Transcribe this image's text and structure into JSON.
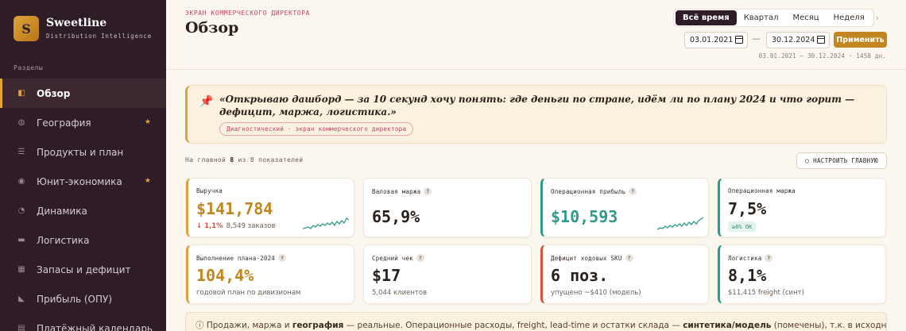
{
  "brand": {
    "logo_letter": "S",
    "name": "Sweetline",
    "subtitle": "Distribution Intelligence"
  },
  "sidebar": {
    "section_label": "Разделы",
    "items": [
      {
        "label": "Обзор",
        "icon": "overview-icon",
        "active": true,
        "star": ""
      },
      {
        "label": "География",
        "icon": "globe-icon",
        "active": false,
        "star": "★"
      },
      {
        "label": "Продукты и план",
        "icon": "list-icon",
        "active": false,
        "star": ""
      },
      {
        "label": "Юнит-экономика",
        "icon": "target-icon",
        "active": false,
        "star": "★"
      },
      {
        "label": "Динамика",
        "icon": "pie-icon",
        "active": false,
        "star": ""
      },
      {
        "label": "Логистика",
        "icon": "truck-icon",
        "active": false,
        "star": ""
      },
      {
        "label": "Запасы и дефицит",
        "icon": "grid-icon",
        "active": false,
        "star": ""
      },
      {
        "label": "Прибыль (ОПУ)",
        "icon": "triangle-icon",
        "active": false,
        "star": ""
      },
      {
        "label": "Платёжный календарь",
        "icon": "calendar-icon",
        "active": false,
        "star": ""
      }
    ]
  },
  "header": {
    "eyebrow": "ЭКРАН КОММЕРЧЕСКОГО ДИРЕКТОРА",
    "title": "Обзор",
    "period_tabs": [
      "Всё время",
      "Квартал",
      "Месяц",
      "Неделя"
    ],
    "active_tab": 0,
    "prev_arrow": "‹",
    "next_arrow": "›",
    "date_from": "03.01.2021",
    "date_to": "30.12.2024",
    "date_sep": "—",
    "apply_label": "Применить",
    "range_text": "03.01.2021 — 30.12.2024 · 1458 дн."
  },
  "quote": {
    "text": "«Открываю дашборд — за 10 секунд хочу понять: где деньги по стране, идём ли по плану 2024 и что горит — дефицит, маржа, логистика.»",
    "tag": "Диагностический · экран коммерческого директора"
  },
  "kpi_bar": {
    "prefix": "На главной",
    "shown": "8",
    "middle": "из",
    "total": "8 показателей",
    "config_label": "НАСТРОИТЬ ГЛАВНУЮ"
  },
  "cards": [
    {
      "label": "Выручка",
      "help": "",
      "value": "$141,784",
      "delta": "↓ 1,1%",
      "sub": "8,549 заказов",
      "badge": "",
      "spark": true
    },
    {
      "label": "Валовая маржа",
      "help": "?",
      "value": "65,9%",
      "delta": "",
      "sub": "",
      "badge": "",
      "spark": false
    },
    {
      "label": "Операционная прибыль",
      "help": "?",
      "value": "$10,593",
      "delta": "",
      "sub": "",
      "badge": "",
      "spark": true
    },
    {
      "label": "Операционная маржа",
      "help": "",
      "value": "7,5%",
      "delta": "",
      "sub": "",
      "badge": "≥6% OK",
      "spark": false
    },
    {
      "label": "Выполнение плана-2024",
      "help": "?",
      "value": "104,4%",
      "delta": "",
      "sub": "годовой план по дивизионам",
      "badge": "",
      "spark": false
    },
    {
      "label": "Средний чек",
      "help": "?",
      "value": "$17",
      "delta": "",
      "sub": "5,044 клиентов",
      "badge": "",
      "spark": false
    },
    {
      "label": "Дефицит ходовых SKU",
      "help": "?",
      "value": "6 поз.",
      "delta": "",
      "sub": "упущено ~$410 (модель)",
      "badge": "",
      "spark": false
    },
    {
      "label": "Логистика",
      "help": "?",
      "value": "8,1%",
      "delta": "",
      "sub": "$11,415 freight (синт)",
      "badge": "",
      "spark": false
    }
  ],
  "notice": {
    "icon": "ⓘ",
    "part1": "Продажи, маржа и",
    "bold1": "география",
    "part2": "— реальные. Операционные расходы, freight, lead-time и остатки склада —",
    "bold2": "синтетика/модель",
    "part3": "(помечены), т.к. в исходных данных их нет."
  },
  "colors": {
    "sidebar_bg": "#2e1c26",
    "accent_gold": "#c1861f",
    "accent_teal": "#2f9a8a",
    "accent_red": "#d0563f",
    "eyebrow_pink": "#c0456e"
  }
}
